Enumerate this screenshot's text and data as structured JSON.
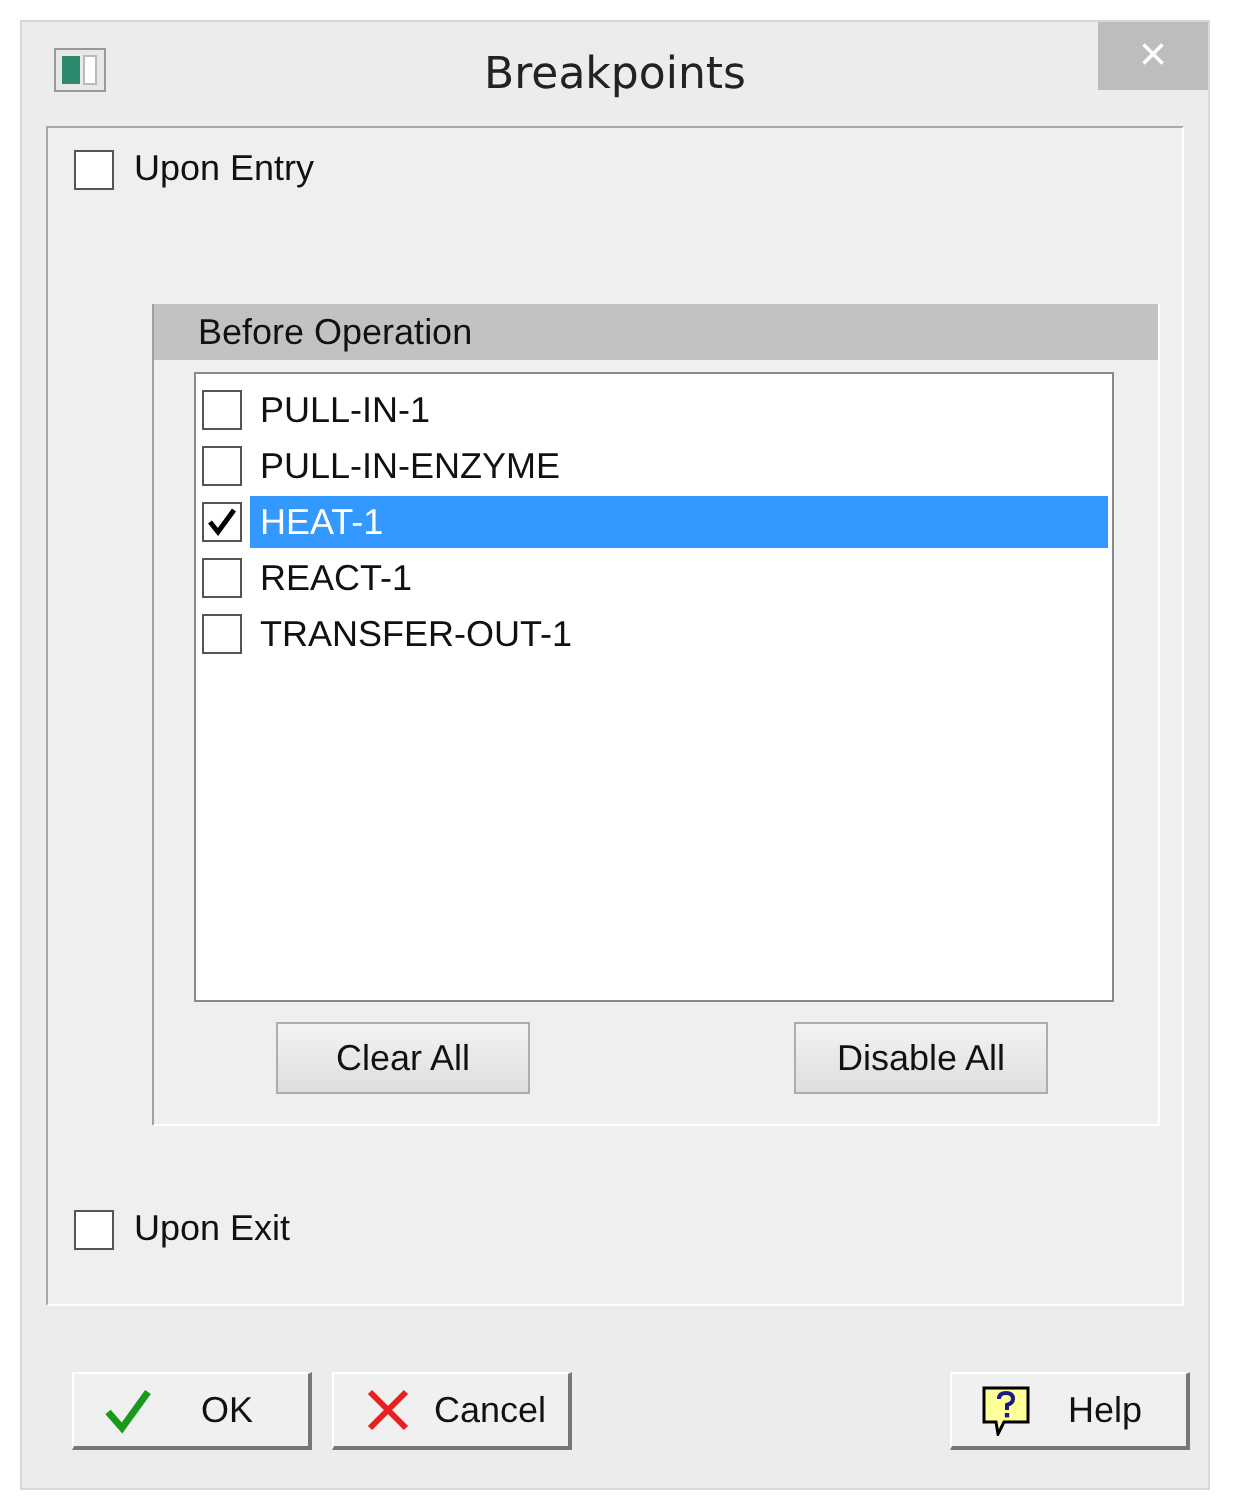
{
  "window": {
    "title": "Breakpoints",
    "close": "×"
  },
  "upon_entry": {
    "label": "Upon Entry",
    "checked": false
  },
  "before_operation": {
    "title": "Before Operation",
    "items": [
      {
        "label": "PULL-IN-1",
        "checked": false,
        "selected": false
      },
      {
        "label": "PULL-IN-ENZYME",
        "checked": false,
        "selected": false
      },
      {
        "label": "HEAT-1",
        "checked": true,
        "selected": true
      },
      {
        "label": "REACT-1",
        "checked": false,
        "selected": false
      },
      {
        "label": "TRANSFER-OUT-1",
        "checked": false,
        "selected": false
      }
    ],
    "buttons": [
      "Clear All",
      "Disable All"
    ]
  },
  "upon_exit": {
    "label": "Upon Exit",
    "checked": false
  },
  "buttons": [
    {
      "kind": "ok",
      "label": "OK"
    },
    {
      "kind": "cancel",
      "label": "Cancel"
    },
    {
      "kind": "help",
      "label": "Help"
    }
  ]
}
